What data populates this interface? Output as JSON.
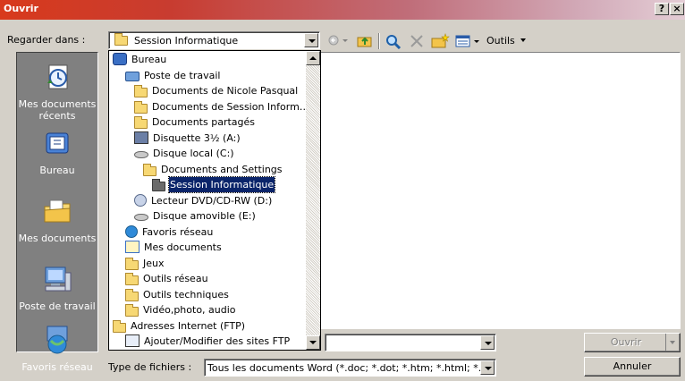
{
  "window": {
    "title": "Ouvrir",
    "help_btn": "?",
    "close_btn": "×"
  },
  "look_in": {
    "label": "Regarder dans :",
    "value": "Session Informatique"
  },
  "toolbar": {
    "tools_label": "Outils",
    "icons": [
      "back-icon",
      "up-folder-icon",
      "search-web-icon",
      "delete-icon",
      "new-folder-icon",
      "views-icon"
    ]
  },
  "places": [
    {
      "label": "Mes documents récents",
      "icon": "recent-documents-icon"
    },
    {
      "label": "Bureau",
      "icon": "desktop-icon"
    },
    {
      "label": "Mes documents",
      "icon": "my-documents-icon"
    },
    {
      "label": "Poste de travail",
      "icon": "my-computer-icon"
    },
    {
      "label": "Favoris réseau",
      "icon": "network-places-icon"
    }
  ],
  "dropdown_items": [
    {
      "label": "Bureau",
      "icon": "desktop",
      "indent": 0
    },
    {
      "label": "Poste de travail",
      "icon": "computer",
      "indent": 1
    },
    {
      "label": "Documents de Nicole Pasqual",
      "icon": "folder",
      "indent": 2
    },
    {
      "label": "Documents de Session Inform…",
      "icon": "folder",
      "indent": 2
    },
    {
      "label": "Documents partagés",
      "icon": "folder",
      "indent": 2
    },
    {
      "label": "Disquette 3½ (A:)",
      "icon": "floppy",
      "indent": 2
    },
    {
      "label": "Disque local (C:)",
      "icon": "disk",
      "indent": 2
    },
    {
      "label": "Documents and Settings",
      "icon": "folder",
      "indent": 3
    },
    {
      "label": "Session Informatique",
      "icon": "folder-open",
      "indent": 4,
      "selected": true
    },
    {
      "label": "Lecteur DVD/CD-RW (D:)",
      "icon": "cd",
      "indent": 2
    },
    {
      "label": "Disque amovible (E:)",
      "icon": "disk",
      "indent": 2
    },
    {
      "label": "Favoris réseau",
      "icon": "globe",
      "indent": 1
    },
    {
      "label": "Mes documents",
      "icon": "docs",
      "indent": 1
    },
    {
      "label": "Jeux",
      "icon": "folder",
      "indent": 1
    },
    {
      "label": "Outils réseau",
      "icon": "folder",
      "indent": 1
    },
    {
      "label": "Outils techniques",
      "icon": "folder",
      "indent": 1
    },
    {
      "label": "Vidéo,photo, audio",
      "icon": "folder",
      "indent": 1
    },
    {
      "label": "Adresses Internet (FTP)",
      "icon": "folder",
      "indent": 0
    },
    {
      "label": "Ajouter/Modifier des sites FTP",
      "icon": "web",
      "indent": 1
    }
  ],
  "filename": {
    "value": ""
  },
  "filetype": {
    "label": "Type de fichiers :",
    "value": "Tous les documents Word (*.doc; *.dot; *.htm; *.html; *."
  },
  "buttons": {
    "open": "Ouvrir",
    "cancel": "Annuler"
  }
}
